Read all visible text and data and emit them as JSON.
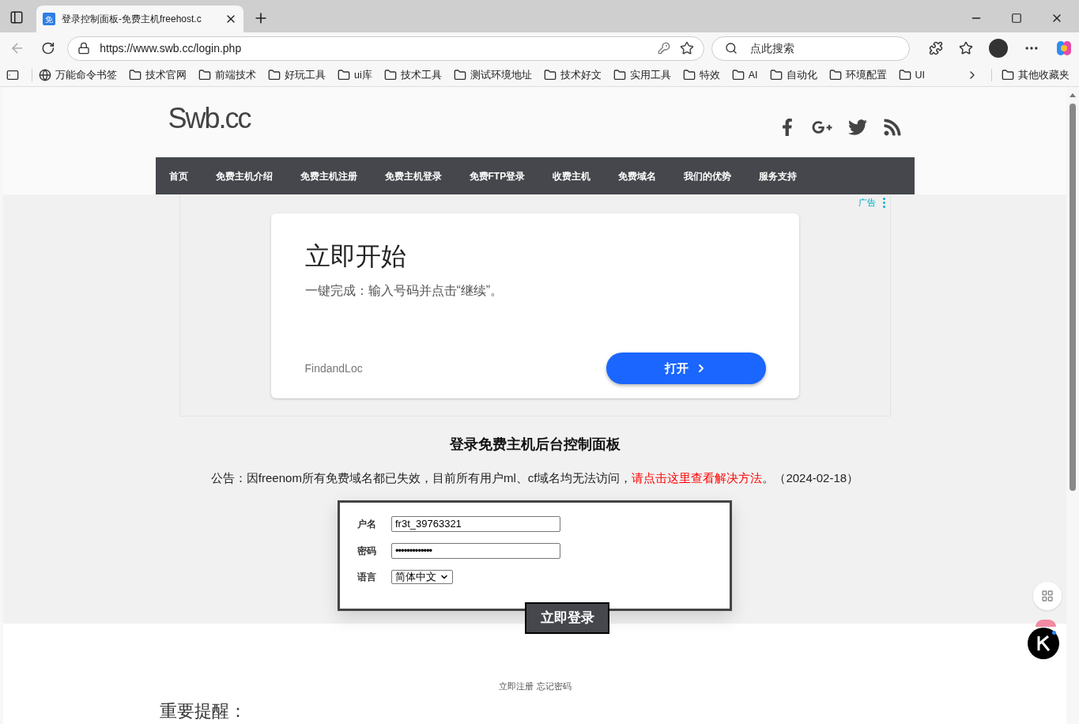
{
  "browser": {
    "tab": {
      "favicon_text": "免",
      "title": "登录控制面板-免费主机freehost.c",
      "selected": true
    },
    "url": "https://www.swb.cc/login.php",
    "search": {
      "placeholder": "点此搜索"
    },
    "bookmarks": [
      {
        "kind": "globe",
        "label": "万能命令书签"
      },
      {
        "kind": "folder",
        "label": "技术官网"
      },
      {
        "kind": "folder",
        "label": "前端技术"
      },
      {
        "kind": "folder",
        "label": "好玩工具"
      },
      {
        "kind": "folder",
        "label": "ui库"
      },
      {
        "kind": "folder",
        "label": "技术工具"
      },
      {
        "kind": "folder",
        "label": "测试环境地址"
      },
      {
        "kind": "folder",
        "label": "技术好文"
      },
      {
        "kind": "folder",
        "label": "实用工具"
      },
      {
        "kind": "folder",
        "label": "特效"
      },
      {
        "kind": "folder",
        "label": "AI"
      },
      {
        "kind": "folder",
        "label": "自动化"
      },
      {
        "kind": "folder",
        "label": "环境配置"
      },
      {
        "kind": "folder",
        "label": "UI"
      }
    ],
    "other_bookmarks": "其他收藏夹"
  },
  "page": {
    "logo": "Swb.cc",
    "nav": [
      "首页",
      "免费主机介绍",
      "免费主机注册",
      "免费主机登录",
      "免费FTP登录",
      "收费主机",
      "免费域名",
      "我们的优势",
      "服务支持"
    ],
    "ad": {
      "label": "广告",
      "headline": "立即开始",
      "subtitle": "一键完成：输入号码并点击“继续”。",
      "advertiser": "FindandLoc",
      "button": "打开"
    },
    "title": "登录免费主机后台控制面板",
    "notice": {
      "text": "公告：因freenom所有免费域名都已失效，目前所有用户ml、cf域名均无法访问，",
      "link": "请点击这里查看解决方法",
      "suffix": "。（2024-02-18）"
    },
    "form": {
      "fields": [
        {
          "kind": "text",
          "label": "户名",
          "value": "fr3t_39763321"
        },
        {
          "kind": "password",
          "label": "密码",
          "value": "•••••••••••••"
        },
        {
          "kind": "select",
          "label": "语言",
          "value": "简体中文"
        }
      ],
      "submit": "立即登录"
    },
    "links": [
      "立即注册",
      "忘记密码"
    ],
    "reminder": "重要提醒："
  }
}
